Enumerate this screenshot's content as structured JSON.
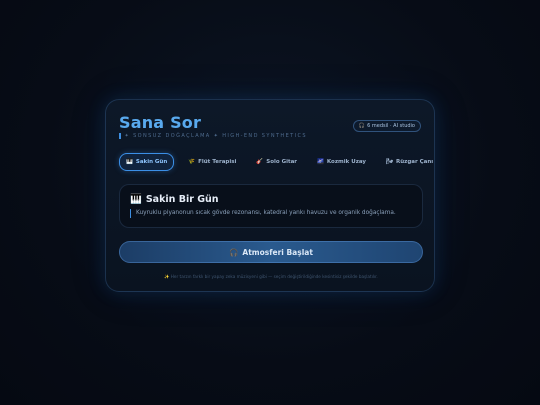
{
  "app": {
    "title": "Sana Sor",
    "subtitle": "✦ SONSUZ DOĞAÇLAMA ✦ HIGH-END SYNTHETICS",
    "badge_icon": "🎧",
    "badge_text": "6 medsil · AI studio"
  },
  "tabs": [
    {
      "icon": "🎹",
      "label": "Sakin Gün",
      "active": true
    },
    {
      "icon": "🌾",
      "label": "Flüt Terapisi",
      "active": false
    },
    {
      "icon": "🎸",
      "label": "Solo Gitar",
      "active": false
    },
    {
      "icon": "🌌",
      "label": "Kozmik Uzay",
      "active": false
    },
    {
      "icon": "🌬",
      "label": "Rüzgar Çanı",
      "active": false
    }
  ],
  "panel": {
    "icon": "🎹",
    "title": "Sakin Bir Gün",
    "description": "Kuyruklu piyanonun sıcak gövde rezonansı, katedral yankı havuzu ve organik doğaçlama."
  },
  "start_button": {
    "icon": "🎧",
    "label": "Atmosferi Başlat"
  },
  "footer": {
    "icon": "✨",
    "text": "Her tarzın farklı bir yapay zeka müzisyeni gibi — seçim değiştirildiğinde kesintisiz şekilde başlatılır."
  },
  "colors": {
    "accent": "#59a9ee",
    "button": "#2a5a8e",
    "background": "#070c16"
  }
}
